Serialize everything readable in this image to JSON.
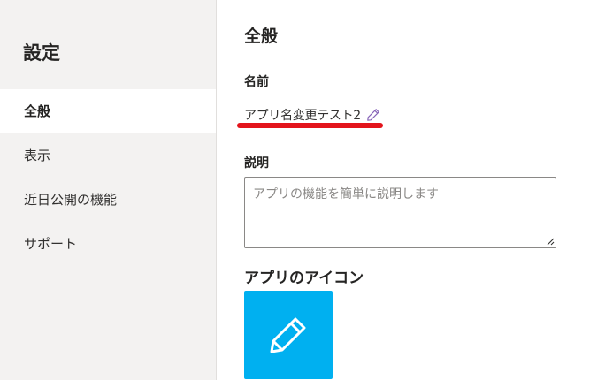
{
  "sidebar": {
    "title": "設定",
    "items": [
      {
        "label": "全般",
        "active": true
      },
      {
        "label": "表示",
        "active": false
      },
      {
        "label": "近日公開の機能",
        "active": false
      },
      {
        "label": "サポート",
        "active": false
      }
    ]
  },
  "main": {
    "section_title": "全般",
    "name": {
      "label": "名前",
      "value": "アプリ名変更テスト2",
      "edit_icon": "pencil-icon"
    },
    "description": {
      "label": "説明",
      "value": "",
      "placeholder": "アプリの機能を簡単に説明します"
    },
    "app_icon": {
      "label": "アプリのアイコン",
      "tile_color": "#00b0f0",
      "icon": "pencil-icon"
    }
  },
  "annotation": {
    "underline_color": "#e3141c"
  }
}
